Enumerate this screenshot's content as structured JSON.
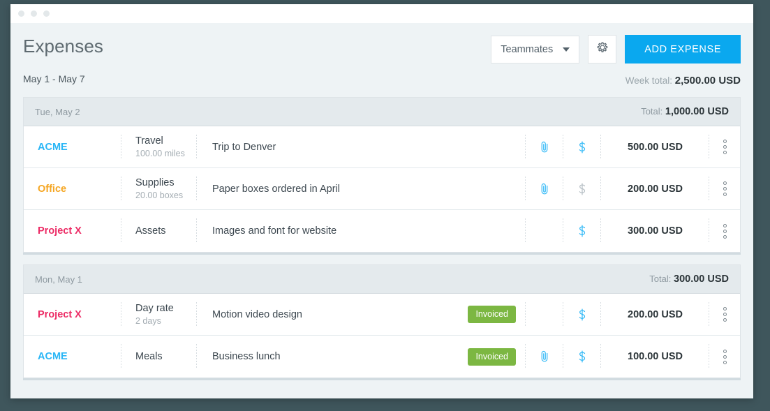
{
  "window": {
    "dots": [
      "dot-1",
      "dot-2",
      "dot-3"
    ]
  },
  "header": {
    "title": "Expenses",
    "teammates_label": "Teammates",
    "settings_icon": "gear-icon",
    "add_expense_label": "ADD EXPENSE",
    "accent_color": "#0aa8ef"
  },
  "subheader": {
    "date_range": "May 1 - May 7",
    "week_total_label": "Week total:",
    "week_total_amount": "2,500.00 USD"
  },
  "groups": [
    {
      "date": "Tue, May 2",
      "total_label": "Total:",
      "total_amount": "1,000.00 USD",
      "rows": [
        {
          "project": "ACME",
          "project_color": "#29b6f6",
          "project_class": "proj-acme",
          "category": "Travel",
          "category_sub": "100.00 miles",
          "description": "Trip to Denver",
          "badge": "",
          "attachment_icon": "paperclip-icon",
          "attachment_active": true,
          "billable_icon": "dollar-icon",
          "billable_active": true,
          "amount": "500.00 USD"
        },
        {
          "project": "Office",
          "project_color": "#f5a623",
          "project_class": "proj-office",
          "category": "Supplies",
          "category_sub": "20.00 boxes",
          "description": "Paper boxes ordered in April",
          "badge": "",
          "attachment_icon": "paperclip-icon",
          "attachment_active": true,
          "billable_icon": "dollar-icon",
          "billable_active": false,
          "amount": "200.00 USD"
        },
        {
          "project": "Project X",
          "project_color": "#ec2a64",
          "project_class": "proj-x",
          "category": "Assets",
          "category_sub": "",
          "description": "Images and font for website",
          "badge": "",
          "attachment_icon": "",
          "attachment_active": false,
          "billable_icon": "dollar-icon",
          "billable_active": true,
          "amount": "300.00 USD"
        }
      ]
    },
    {
      "date": "Mon, May 1",
      "total_label": "Total:",
      "total_amount": "300.00 USD",
      "rows": [
        {
          "project": "Project X",
          "project_color": "#ec2a64",
          "project_class": "proj-x",
          "category": "Day rate",
          "category_sub": "2 days",
          "description": "Motion video design",
          "badge": "Invoiced",
          "attachment_icon": "",
          "attachment_active": false,
          "billable_icon": "dollar-icon",
          "billable_active": true,
          "amount": "200.00 USD"
        },
        {
          "project": "ACME",
          "project_color": "#29b6f6",
          "project_class": "proj-acme",
          "category": "Meals",
          "category_sub": "",
          "description": "Business lunch",
          "badge": "Invoiced",
          "attachment_icon": "paperclip-icon",
          "attachment_active": true,
          "billable_icon": "dollar-icon",
          "billable_active": true,
          "amount": "100.00 USD"
        }
      ]
    }
  ],
  "row_menu_icon": "kebab-menu-icon",
  "badge_color": "#7cb742"
}
